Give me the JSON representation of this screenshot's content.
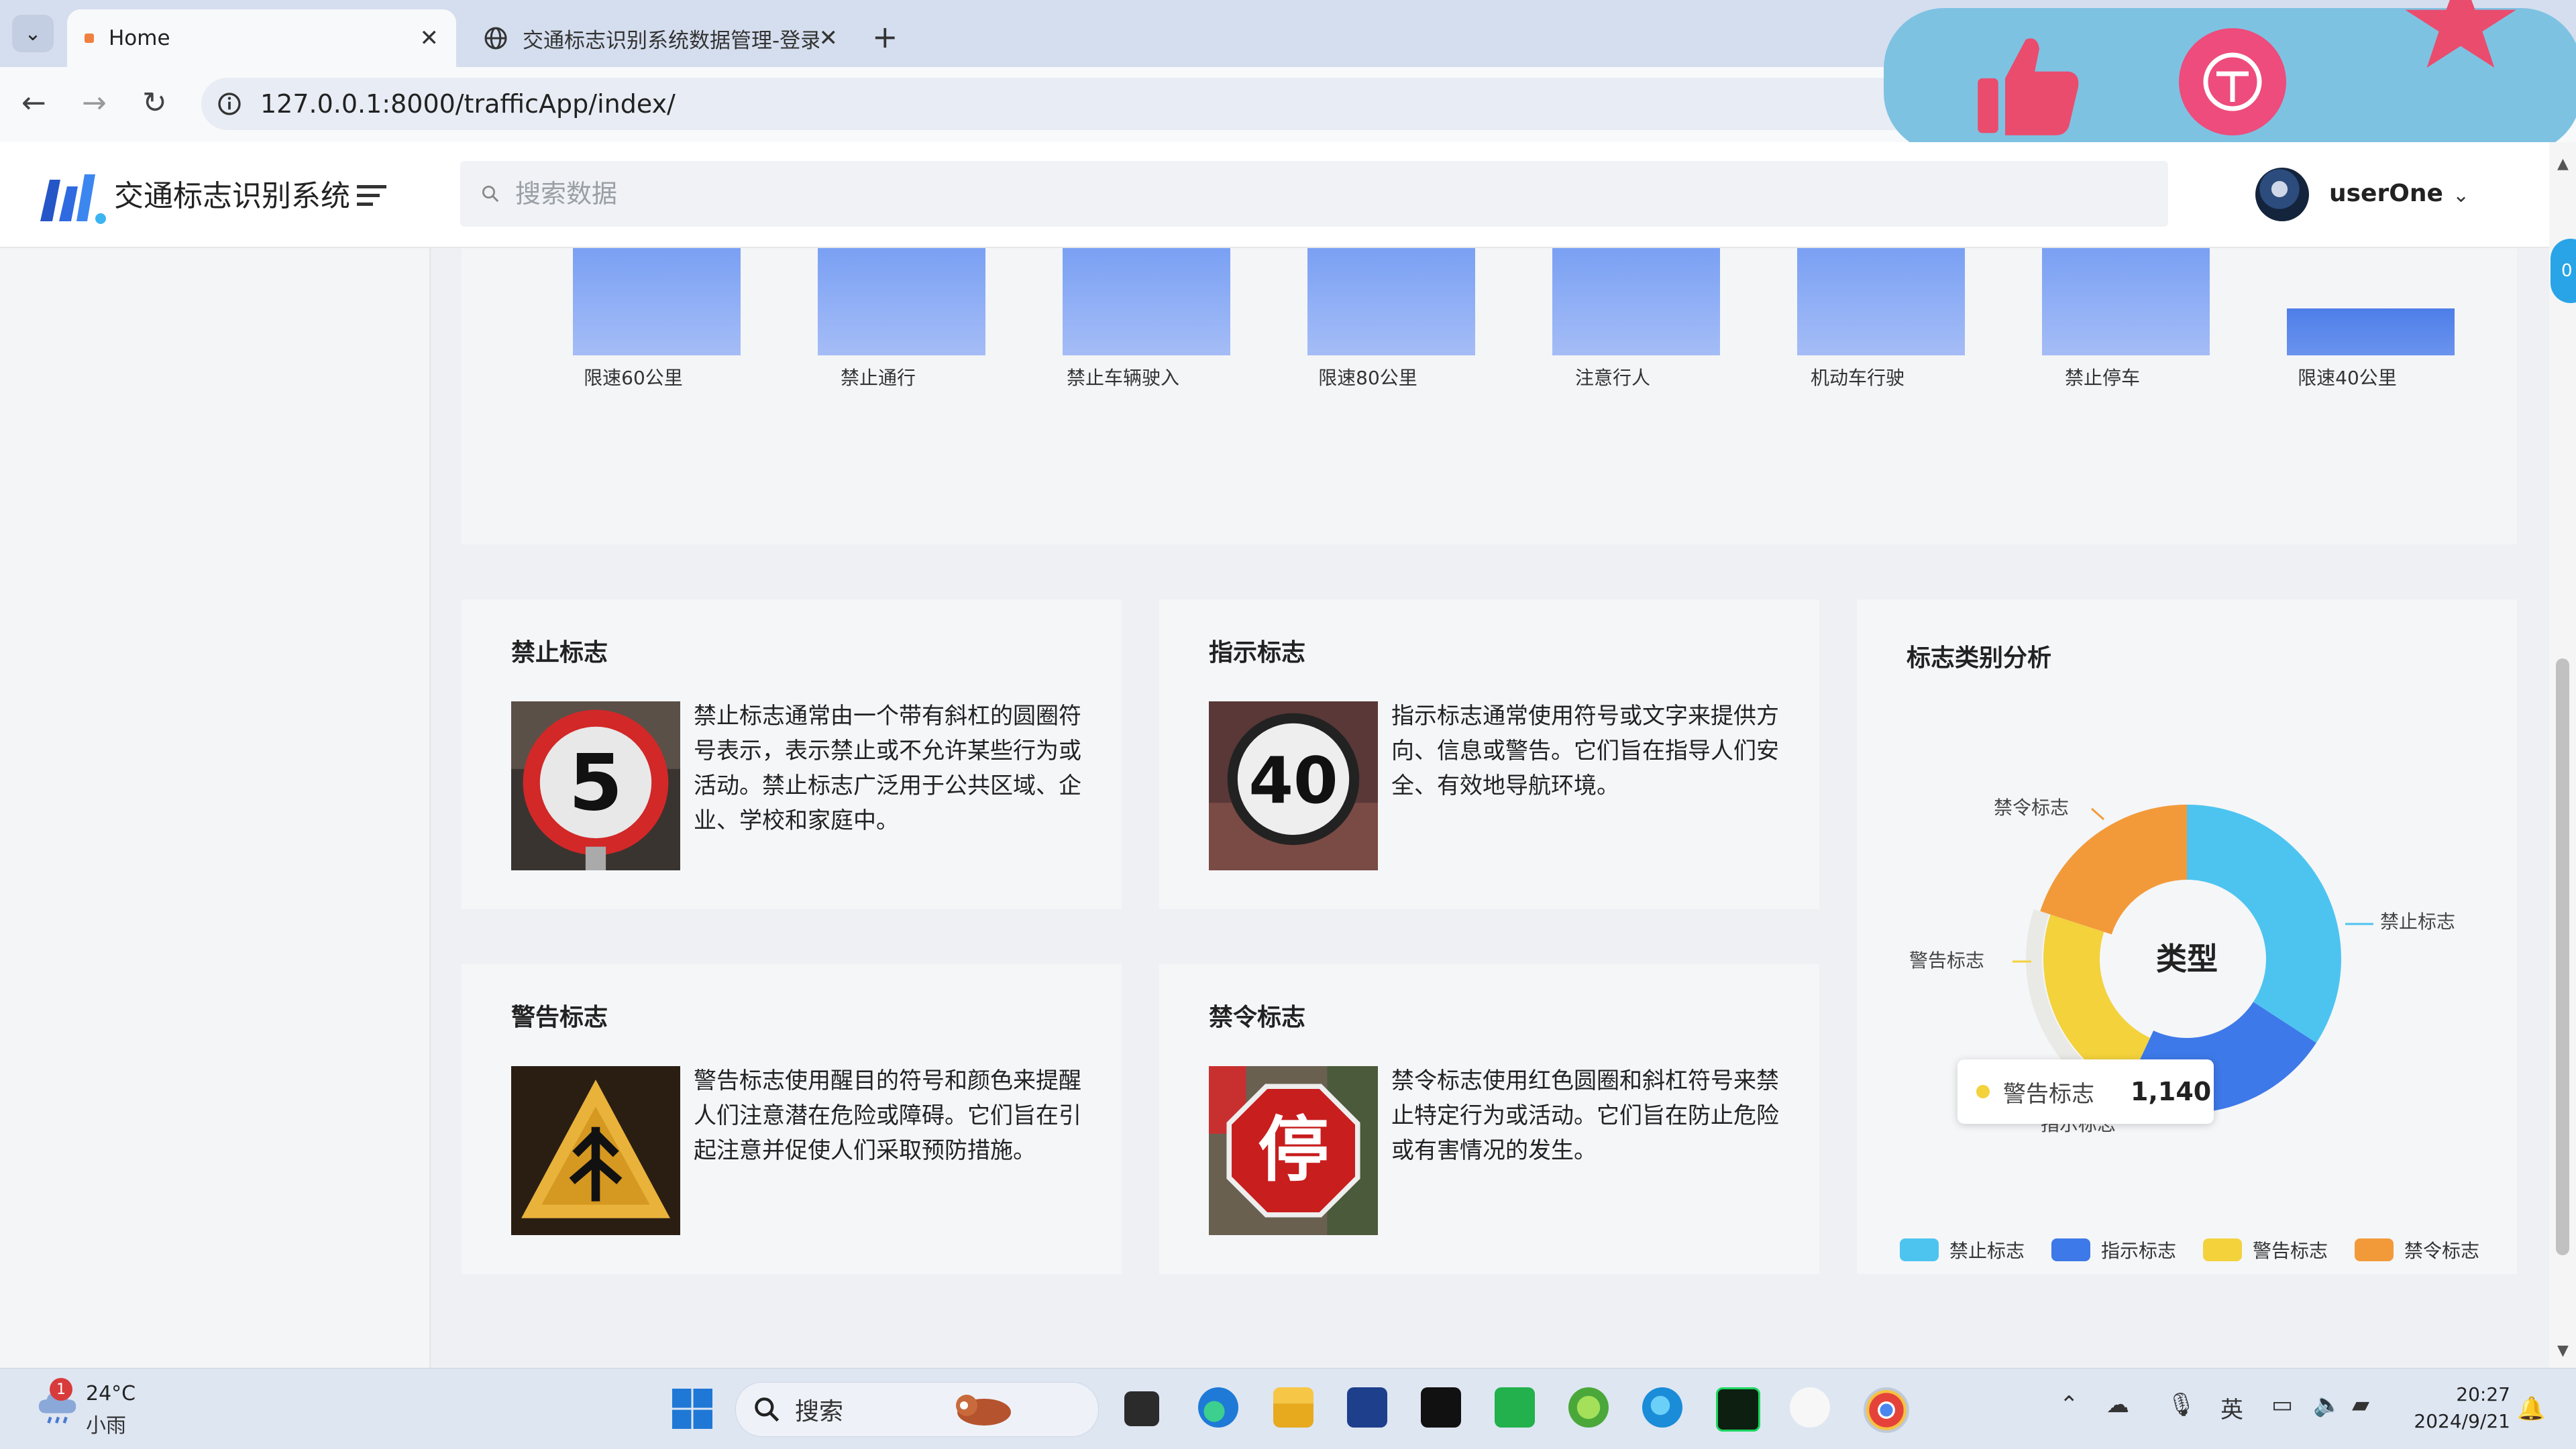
{
  "browser": {
    "tabs": [
      {
        "title": "Home",
        "active": true
      },
      {
        "title": "交通标志识别系统数据管理-登录",
        "active": false
      }
    ],
    "url": "127.0.0.1:8000/trafficApp/index/"
  },
  "app": {
    "title": "交通标志识别系统",
    "search_placeholder": "搜索数据",
    "user": "userOne"
  },
  "scroll_badge": "0",
  "chart_data": [
    {
      "type": "bar",
      "categories": [
        "限速60公里",
        "禁止通行",
        "禁止车辆驶入",
        "限速80公里",
        "注意行人",
        "机动车行驶",
        "禁止停车",
        "限速40公里"
      ],
      "bar_color": "#8aabf5"
    },
    {
      "type": "pie",
      "title": "标志类别分析",
      "center_label": "类型",
      "labels": [
        "禁止标志",
        "指示标志",
        "警告标志",
        "禁令标志"
      ],
      "colors": [
        "#4dc4f0",
        "#3d79e8",
        "#f3d23c",
        "#f29a3a"
      ],
      "tooltip": {
        "label": "警告标志",
        "value": "1,140"
      }
    }
  ],
  "cards": [
    {
      "title": "禁止标志",
      "desc": "禁止标志通常由一个带有斜杠的圆圈符号表示，表示禁止或不允许某些行为或活动。禁止标志广泛用于公共区域、企业、学校和家庭中。",
      "image": "speed-limit-5-sign"
    },
    {
      "title": "指示标志",
      "desc": "指示标志通常使用符号或文字来提供方向、信息或警告。它们旨在指导人们安全、有效地导航环境。",
      "image": "speed-limit-40-sign"
    },
    {
      "title": "警告标志",
      "desc": "警告标志使用醒目的符号和颜色来提醒人们注意潜在危险或障碍。它们旨在引起注意并促使人们采取预防措施。",
      "image": "warning-triangle-sign"
    },
    {
      "title": "禁令标志",
      "desc": "禁令标志使用红色圆圈和斜杠符号来禁止特定行为或活动。它们旨在防止危险或有害情况的发生。",
      "image": "stop-sign"
    }
  ],
  "taskbar": {
    "weather_temp": "24°C",
    "weather_cond": "小雨",
    "weather_badge": "1",
    "search_label": "搜索",
    "ime": "英",
    "time": "20:27",
    "date": "2024/9/21"
  }
}
